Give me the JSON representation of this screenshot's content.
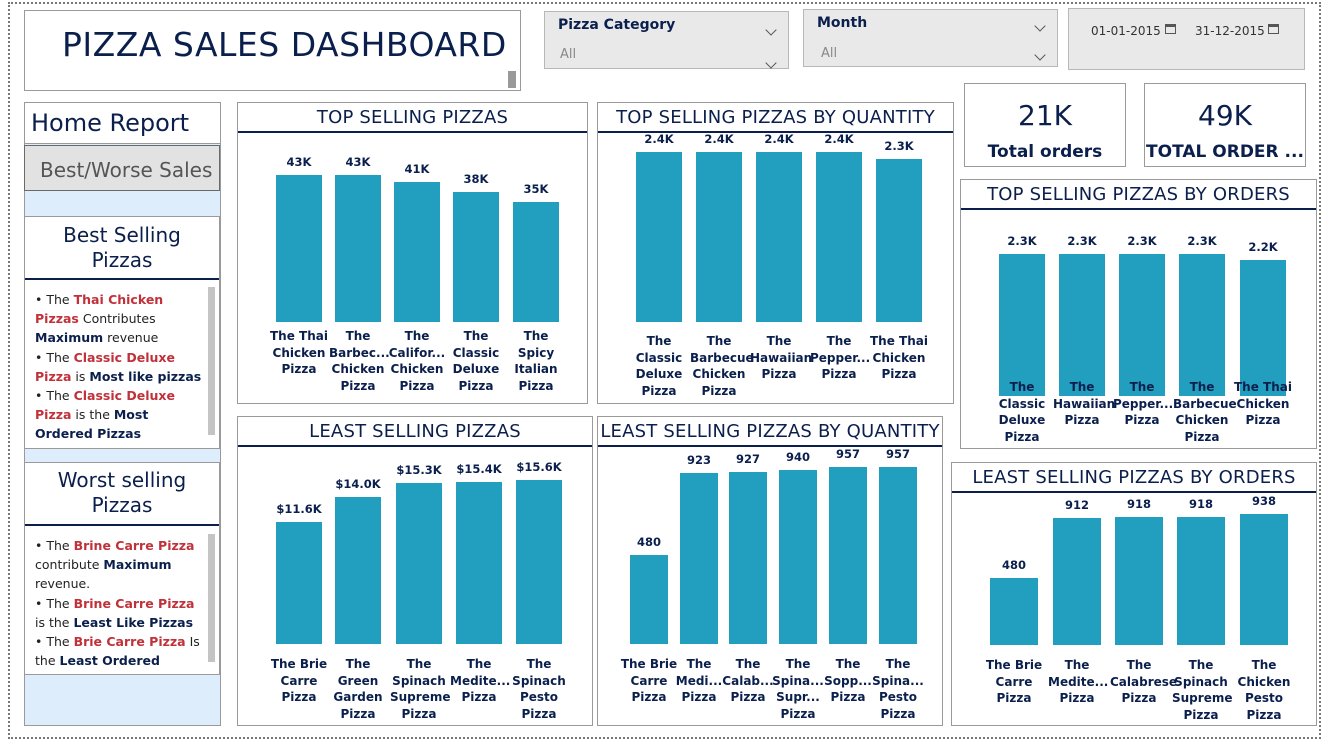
{
  "title": "PIZZA SALES DASHBOARD",
  "slicers": {
    "category": {
      "label": "Pizza Category",
      "value": "All"
    },
    "month": {
      "label": "Month",
      "value": "All"
    },
    "date_start": "01-01-2015",
    "date_end": "31-12-2015"
  },
  "nav": {
    "home": "Home Report",
    "best_worse": "Best/Worse Sales"
  },
  "best_card": {
    "title": "Best Selling Pizzas",
    "lines": [
      [
        [
          "• The ",
          ""
        ],
        [
          "Thai Chicken Pizzas",
          "red"
        ],
        [
          " Contributes ",
          ""
        ],
        [
          "Maximum",
          "navy"
        ],
        [
          " revenue",
          ""
        ]
      ],
      [
        [
          "• The  ",
          ""
        ],
        [
          "Classic  Deluxe Pizza",
          "red"
        ],
        [
          " is ",
          ""
        ],
        [
          "Most like pizzas",
          "navy"
        ]
      ],
      [
        [
          "• The ",
          ""
        ],
        [
          "Classic Deluxe Pizza",
          "red"
        ],
        [
          " is the ",
          ""
        ],
        [
          "Most Ordered Pizzas",
          "navy"
        ]
      ]
    ]
  },
  "worst_card": {
    "title": "Worst selling Pizzas",
    "lines": [
      [
        [
          "• The ",
          ""
        ],
        [
          "Brine Carre Pizza",
          "red"
        ],
        [
          " contribute ",
          ""
        ],
        [
          "Maximum",
          "navy"
        ],
        [
          " revenue.",
          ""
        ]
      ],
      [
        [
          "• The ",
          ""
        ],
        [
          "Brine Carre Pizza",
          "red"
        ],
        [
          " is the ",
          ""
        ],
        [
          "Least Like Pizzas",
          "navy"
        ]
      ],
      [
        [
          "• The ",
          ""
        ],
        [
          "Brie Carre Pizza",
          "red"
        ],
        [
          " Is the ",
          ""
        ],
        [
          "Least Ordered",
          "navy"
        ]
      ]
    ]
  },
  "kpis": [
    {
      "value": "21K",
      "label": "Total orders"
    },
    {
      "value": "49K",
      "label": "TOTAL ORDER ..."
    }
  ],
  "chart_data": [
    {
      "id": "top_revenue",
      "type": "bar",
      "title": "TOP SELLING PIZZAS",
      "categories": [
        "The Thai Chicken Pizza",
        "The Barbec... Chicken Pizza",
        "The Califor... Chicken Pizza",
        "The Classic Deluxe Pizza",
        "The Spicy Italian Pizza"
      ],
      "values": [
        43000,
        43000,
        41000,
        38000,
        35000
      ],
      "data_labels": [
        "43K",
        "43K",
        "41K",
        "38K",
        "35K"
      ],
      "ylim": [
        0,
        45000
      ]
    },
    {
      "id": "top_quantity",
      "type": "bar",
      "title": "TOP SELLING PIZZAS BY QUANTITY",
      "categories": [
        "The Classic Deluxe Pizza",
        "The Barbecue Chicken Pizza",
        "The Hawaiian Pizza",
        "The Pepper... Pizza",
        "The Thai Chicken Pizza"
      ],
      "values": [
        2400,
        2400,
        2400,
        2400,
        2300
      ],
      "data_labels": [
        "2.4K",
        "2.4K",
        "2.4K",
        "2.4K",
        "2.3K"
      ],
      "ylim": [
        0,
        2400
      ]
    },
    {
      "id": "top_orders",
      "type": "bar",
      "title": "TOP SELLING PIZZAS BY ORDERS",
      "categories": [
        "The Classic Deluxe Pizza",
        "The Hawaiian Pizza",
        "The Pepper... Pizza",
        "The Barbecue Chicken Pizza",
        "The Thai Chicken Pizza"
      ],
      "values": [
        2300,
        2300,
        2300,
        2300,
        2200
      ],
      "data_labels": [
        "2.3K",
        "2.3K",
        "2.3K",
        "2.3K",
        "2.2K"
      ],
      "ylim": [
        0,
        2350
      ]
    },
    {
      "id": "least_revenue",
      "type": "bar",
      "title": "LEAST SELLING PIZZAS",
      "categories": [
        "The Brie Carre Pizza",
        "The Green Garden Pizza",
        "The Spinach Supreme Pizza",
        "The Medite... Pizza",
        "The Spinach Pesto Pizza"
      ],
      "values": [
        11600,
        14000,
        15300,
        15400,
        15600
      ],
      "data_labels": [
        "$11.6K",
        "$14.0K",
        "$15.3K",
        "$15.4K",
        "$15.6K"
      ],
      "ylim": [
        0,
        16000
      ]
    },
    {
      "id": "least_quantity",
      "type": "bar",
      "title": "LEAST SELLING PIZZAS BY QUANTITY",
      "categories": [
        "The Brie Carre Pizza",
        "The Medi... Pizza",
        "The Calab... Pizza",
        "The Spina... Supr... Pizza",
        "The Sopp... Pizza",
        "The Spina... Pesto Pizza"
      ],
      "values": [
        480,
        923,
        927,
        940,
        957,
        957
      ],
      "data_labels": [
        "480",
        "923",
        "927",
        "940",
        "957",
        "957"
      ],
      "ylim": [
        0,
        960
      ]
    },
    {
      "id": "least_orders",
      "type": "bar",
      "title": "LEAST SELLING PIZZAS BY ORDERS",
      "categories": [
        "The Brie Carre Pizza",
        "The Medite... Pizza",
        "The Calabrese Pizza",
        "The Spinach Supreme Pizza",
        "The Chicken Pesto Pizza"
      ],
      "values": [
        480,
        912,
        918,
        918,
        938
      ],
      "data_labels": [
        "480",
        "912",
        "918",
        "918",
        "938"
      ],
      "ylim": [
        0,
        940
      ]
    }
  ]
}
